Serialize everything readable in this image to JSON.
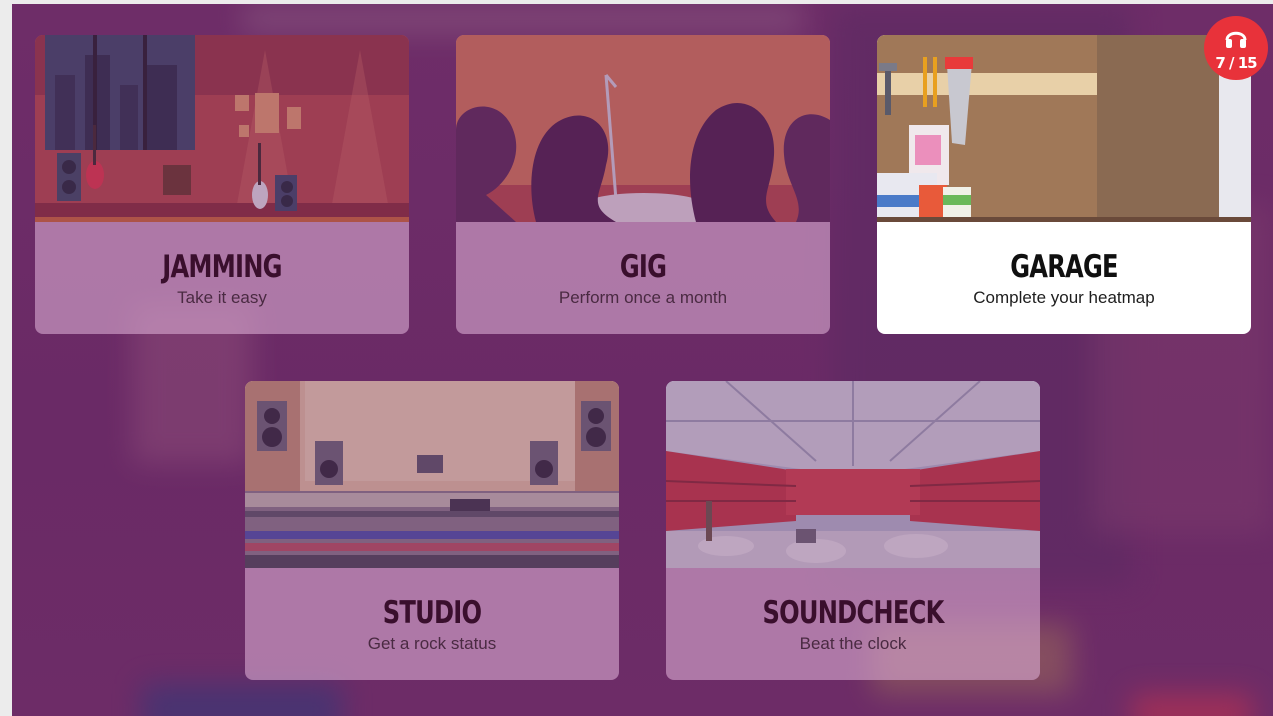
{
  "modes": [
    {
      "id": "jamming",
      "title": "JAMMING",
      "subtitle": "Take it easy",
      "selected": false
    },
    {
      "id": "gig",
      "title": "GIG",
      "subtitle": "Perform once a month",
      "selected": false
    },
    {
      "id": "garage",
      "title": "GARAGE",
      "subtitle": "Complete your heatmap",
      "selected": true
    },
    {
      "id": "studio",
      "title": "STUDIO",
      "subtitle": "Get a rock status",
      "selected": false
    },
    {
      "id": "soundcheck",
      "title": "SOUNDCHECK",
      "subtitle": "Beat the clock",
      "selected": false
    }
  ],
  "progress_badge": {
    "icon": "headphones-icon",
    "count": "7 / 15",
    "color": "#e8323a"
  },
  "colors": {
    "background": "#6e2d68",
    "card_tint": "#d6a8ce",
    "selected_card": "#ffffff"
  }
}
